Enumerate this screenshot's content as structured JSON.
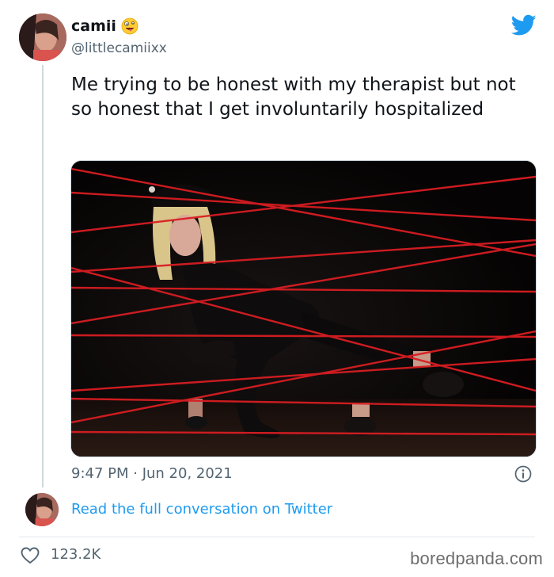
{
  "user": {
    "display_name": "camii",
    "handle": "@littlecamiixx",
    "emoji_icon": "zany-face-emoji-icon"
  },
  "tweet": {
    "text": "Me trying to be honest with my therapist but not so honest that I get involuntarily hospitalized",
    "timestamp": "9:47 PM · Jun 20, 2021",
    "likes": "123.2K",
    "read_more": "Read the full conversation on Twitter"
  },
  "media": {
    "subject": "person-crawling-through-laser-beams"
  },
  "watermark": "boredpanda.com",
  "colors": {
    "twitter_blue": "#1d9bf0",
    "laser_red": "#d81d22",
    "secondary_text": "#536471"
  },
  "icons": {
    "brand": "twitter-bird-icon",
    "info": "info-icon",
    "like": "heart-icon"
  }
}
